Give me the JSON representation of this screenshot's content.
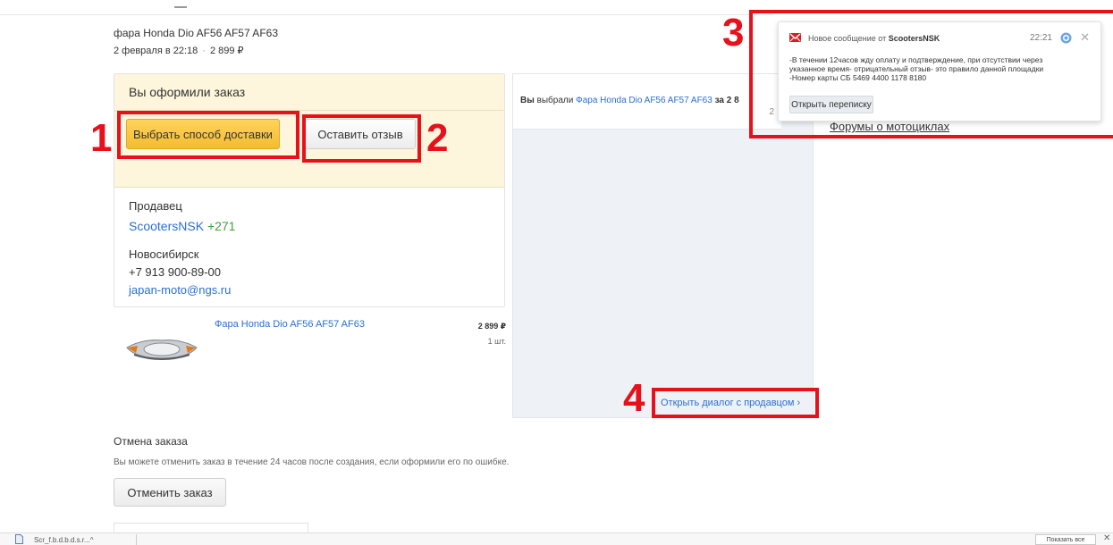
{
  "order": {
    "item_title": "фара Honda Dio AF56 AF57 AF63",
    "date": "2 февраля в 22:18",
    "separator": "·",
    "price": "2 899 ₽"
  },
  "order_card": {
    "status_title": "Вы оформили заказ",
    "delivery_button": "Выбрать способ доставки",
    "review_button": "Оставить отзыв"
  },
  "seller": {
    "label": "Продавец",
    "name": "ScootersNSK",
    "rating": "+271",
    "city": "Новосибирск",
    "phone": "+7 913 900-89-00",
    "email": "japan-moto@ngs.ru"
  },
  "product": {
    "link": "Фара Honda Dio AF56 AF57 AF63",
    "price": "2 899 ₽",
    "qty": "1 шт."
  },
  "chat": {
    "msg_you": "Вы",
    "msg_text": "выбрали",
    "msg_link": "Фара Honda Dio AF56 AF57 AF63",
    "msg_tail": "за 2 8",
    "msg_sub": "2",
    "open_dialog": "Открыть диалог с продавцом ›"
  },
  "forum_link": "Форумы о мотоциклах",
  "cancel": {
    "title": "Отмена заказа",
    "desc": "Вы можете отменить заказ в течение 24 часов после создания, если оформили его по ошибке.",
    "button": "Отменить заказ"
  },
  "notification": {
    "title_prefix": "Новое сообщение от",
    "sender": "ScootersNSK",
    "time": "22:21",
    "body_line1": "-В течении 12часов жду оплату и подтверждение, при отсутствии через",
    "body_line2": "указанное время- отрицательный отзыв- это правило данной площадки",
    "body_line3": "-Номер карты СБ 5469 4400 1178 8180",
    "button": "Открыть переписку"
  },
  "annotations": {
    "n1": "1",
    "n2": "2",
    "n3": "3",
    "n4": "4",
    "color": "#e8101b"
  },
  "downloads": {
    "file": "Scr_f.b.d.b.d.s.r...^",
    "show_all": "Показать все",
    "close": "✕"
  },
  "icons": {
    "mail": "mail-icon",
    "gear": "gear-icon",
    "close": "close-icon",
    "file": "file-icon",
    "headlight": "headlight-image"
  },
  "colors": {
    "link": "#2a6fd6",
    "rating": "#3ea33a",
    "order_bg": "#fdf6dc",
    "primary_button": "#f4bd2f",
    "chat_bg": "#eef2f6"
  }
}
